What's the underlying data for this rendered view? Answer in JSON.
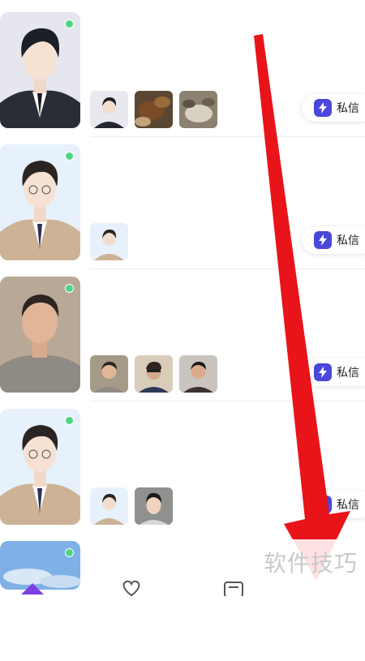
{
  "feed": {
    "items": [
      {
        "online": true,
        "message_label": "私信",
        "photo_count": 3
      },
      {
        "online": true,
        "message_label": "私信",
        "photo_count": 1
      },
      {
        "online": true,
        "message_label": "私信",
        "photo_count": 3
      },
      {
        "online": true,
        "message_label": "私信",
        "photo_count": 2
      },
      {
        "online": true
      }
    ]
  },
  "bottom_nav": {
    "icons": [
      "home-icon",
      "heart-icon",
      "chat-icon"
    ]
  },
  "watermark": {
    "text": "软件技巧"
  },
  "colors": {
    "online": "#4fd483",
    "message_icon": "#4a47d9",
    "arrow": "#e8141a"
  }
}
